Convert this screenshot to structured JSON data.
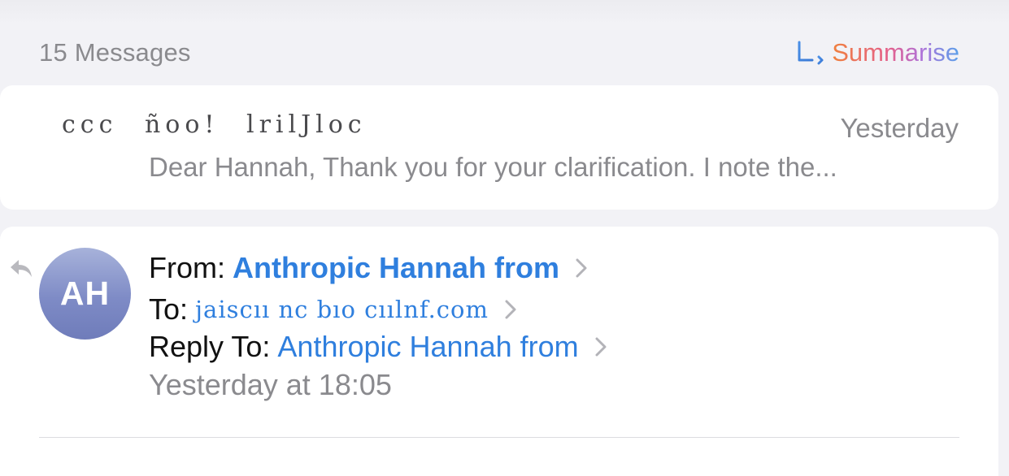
{
  "thread": {
    "message_count": "15 Messages",
    "summarise_label": "Summarise"
  },
  "collapsed_message": {
    "sender": "ccc ñoo! lrilJloc",
    "date": "Yesterday",
    "preview": "Dear Hannah, Thank you for your clarification. I note the..."
  },
  "expanded_message": {
    "avatar_initials": "AH",
    "from_label": "From:",
    "from_name": "Anthropic Hannah from",
    "to_label": "To:",
    "to_address": "jaiscıı nc bıo cıılnf.com",
    "reply_to_label": "Reply To:",
    "reply_to_name": "Anthropic Hannah from",
    "sent_time": "Yesterday at 18:05"
  },
  "colors": {
    "link_blue": "#2f7fde",
    "secondary_gray": "#8a8a8e",
    "avatar_top": "#a7b2da",
    "avatar_bottom": "#6f7cba",
    "background": "#f2f2f7"
  },
  "icons": {
    "summarise": "summarise-icon",
    "replied": "reply-icon",
    "chevron": "chevron-right-icon"
  }
}
